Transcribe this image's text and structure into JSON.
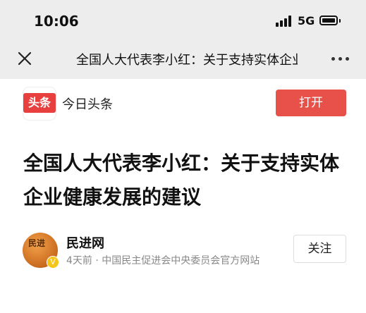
{
  "status_bar": {
    "time": "10:06",
    "network": "5G"
  },
  "nav_bar": {
    "title": "全国人大代表李小红：关于支持实体企业健康发展的建议",
    "close_icon": "close-icon",
    "more_icon": "more-icon"
  },
  "app_banner": {
    "logo_text": "头条",
    "app_name": "今日头条",
    "open_label": "打开",
    "brand_color": "#e8403e"
  },
  "article": {
    "title": "全国人大代表李小红：关于支持实体企业健康发展的建议",
    "author": {
      "name": "民进网",
      "meta": "4天前 · 中国民主促进会中央委员会官方网站",
      "avatar_text": "民进",
      "badge": "V",
      "follow_label": "关注"
    }
  }
}
